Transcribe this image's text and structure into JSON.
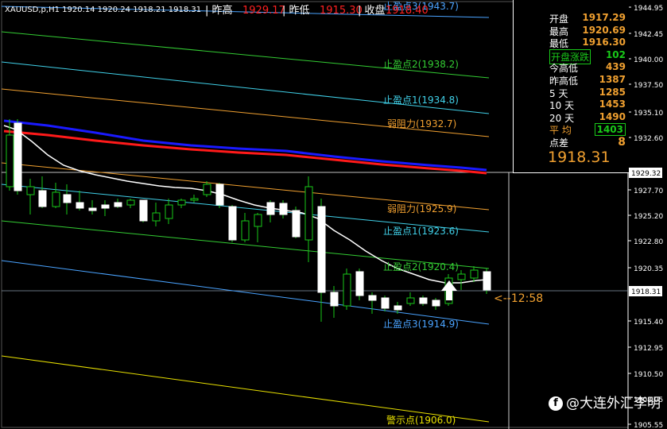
{
  "header": {
    "symbol_line": "XAUUSD,p,H1  1920.14 1920.24 1918.21 1918.31",
    "items": [
      {
        "label": "| 昨高",
        "value": "1929.17"
      },
      {
        "label": "| 昨低",
        "value": "1915.30"
      },
      {
        "label": "| 收盘",
        "value": "1918.40"
      }
    ]
  },
  "info_panel": {
    "rows": [
      {
        "label": "开盘",
        "value": "1917.29",
        "label_color": "#ffffff",
        "value_color": "#f0a030"
      },
      {
        "label": "最高",
        "value": "1920.69",
        "label_color": "#ffffff",
        "value_color": "#f0a030"
      },
      {
        "label": "最低",
        "value": "1916.30",
        "label_color": "#ffffff",
        "value_color": "#f0a030"
      },
      {
        "label": "开盘涨跌",
        "value": "102",
        "label_color": "#19c919",
        "value_color": "#19c919"
      },
      {
        "label": "今高低",
        "value": "439",
        "label_color": "#ffffff",
        "value_color": "#f0a030"
      },
      {
        "label": "昨高低",
        "value": "1387",
        "label_color": "#ffffff",
        "value_color": "#f0a030"
      },
      {
        "label": "5  天",
        "value": "1285",
        "label_color": "#ffffff",
        "value_color": "#f0a030"
      },
      {
        "label": "10 天",
        "value": "1453",
        "label_color": "#ffffff",
        "value_color": "#f0a030"
      },
      {
        "label": "20 天",
        "value": "1490",
        "label_color": "#ffffff",
        "value_color": "#f0a030"
      },
      {
        "label": "平  均",
        "value": "1403",
        "label_color": "#f0a030",
        "value_color": "#19c919"
      },
      {
        "label": "点差",
        "value": "8",
        "label_color": "#ffffff",
        "value_color": "#f0a030"
      }
    ],
    "big_price": "1918.31"
  },
  "levels": [
    {
      "label": "止盈点3(1943.7)",
      "color": "#4aa3ff"
    },
    {
      "label": "止盈点2(1938.2)",
      "color": "#33cc33"
    },
    {
      "label": "止盈点1(1934.8)",
      "color": "#40d0e8"
    },
    {
      "label": "弱阻力(1932.7)",
      "color": "#f0a030"
    },
    {
      "label": "弱阻力(1925.9)",
      "color": "#f0a030"
    },
    {
      "label": "止盈点1(1923.6)",
      "color": "#40d0e8"
    },
    {
      "label": "止盈点2(1920.4)",
      "color": "#33cc33"
    },
    {
      "label": "止盈点3(1914.9)",
      "color": "#4aa3ff"
    },
    {
      "label": "警示点(1906.0)",
      "color": "#e8e000"
    }
  ],
  "countdown": "<--12:58",
  "y_axis": {
    "ticks": [
      "1944.95",
      "1942.45",
      "1940.00",
      "1937.50",
      "1935.10",
      "1932.60",
      "1929.32",
      "1927.70",
      "1925.20",
      "1922.80",
      "1920.35",
      "1918.31",
      "1915.40",
      "1912.95",
      "1910.50",
      "1908.05",
      "1905.55"
    ],
    "markers": [
      {
        "label": "1929.32"
      },
      {
        "label": "1918.31"
      }
    ]
  },
  "watermark": {
    "icon": "f",
    "text": "@大连外汇李明"
  },
  "colors": {
    "bull": "#ffffff",
    "bear": "#ffffff",
    "wick": "#19c919",
    "ma_white": "#ffffff",
    "ma_blue": "#1a1aff",
    "ma_red": "#ff1a1a"
  }
}
